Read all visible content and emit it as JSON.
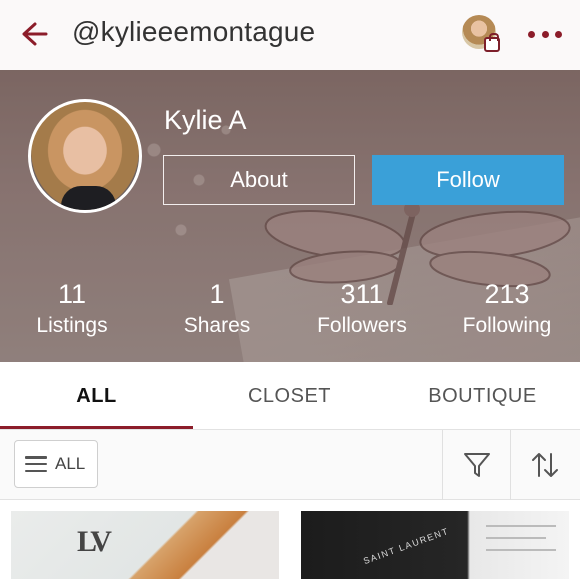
{
  "header": {
    "username": "@kylieeemontague"
  },
  "profile": {
    "name": "Kylie A",
    "about_label": "About",
    "follow_label": "Follow"
  },
  "stats": [
    {
      "value": "11",
      "label": "Listings"
    },
    {
      "value": "1",
      "label": "Shares"
    },
    {
      "value": "311",
      "label": "Followers"
    },
    {
      "value": "213",
      "label": "Following"
    }
  ],
  "tabs": [
    {
      "label": "ALL",
      "active": true
    },
    {
      "label": "CLOSET",
      "active": false
    },
    {
      "label": "BOUTIQUE",
      "active": false
    }
  ],
  "filter": {
    "all_label": "ALL"
  },
  "colors": {
    "accent": "#8c1d2a",
    "follow_button": "#3aa0d8"
  },
  "icons": {
    "back": "back-arrow-icon",
    "more": "more-dots-icon",
    "menu": "hamburger-menu-icon",
    "filter": "funnel-filter-icon",
    "sort": "sort-arrows-icon",
    "bag": "shopping-bag-icon"
  }
}
